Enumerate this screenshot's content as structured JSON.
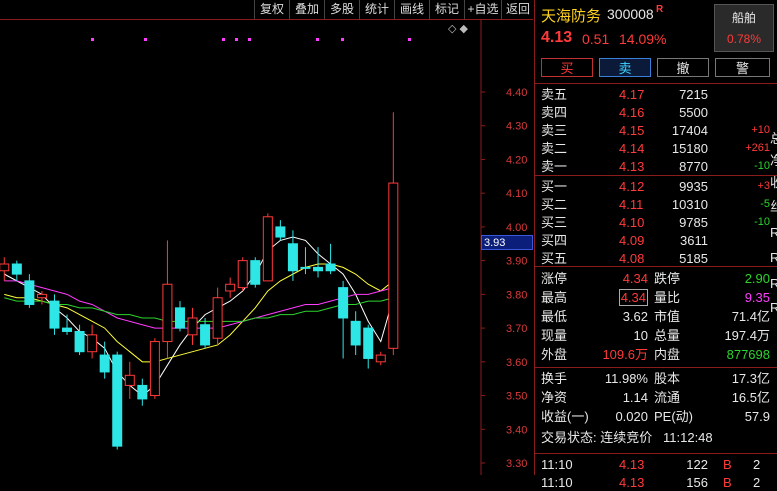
{
  "toolbar": {
    "items": [
      "复权",
      "叠加",
      "多股",
      "统计",
      "画线",
      "标记",
      "+自选",
      "返回"
    ]
  },
  "chart": {
    "price_ticks": [
      "4.40",
      "4.30",
      "4.20",
      "4.10",
      "4.00",
      "3.90",
      "3.80",
      "3.70",
      "3.60",
      "3.50",
      "3.40",
      "3.30"
    ],
    "current_price_tag": "3.93",
    "corner_glyphs": "◇ ◆"
  },
  "stock": {
    "name": "天海防务",
    "code": "300008",
    "badge": "R",
    "price": "4.13",
    "change": "0.51",
    "change_pct": "14.09%",
    "industry": "船舶",
    "industry_pct": "0.78%"
  },
  "trade_buttons": {
    "buy": "买",
    "sell": "卖",
    "cancel": "撤",
    "alert": "警"
  },
  "asks": [
    {
      "label": "卖五",
      "price": "4.17",
      "vol": "7215",
      "chg": ""
    },
    {
      "label": "卖四",
      "price": "4.16",
      "vol": "5500",
      "chg": ""
    },
    {
      "label": "卖三",
      "price": "4.15",
      "vol": "17404",
      "chg": "+10"
    },
    {
      "label": "卖二",
      "price": "4.14",
      "vol": "15180",
      "chg": "+261"
    },
    {
      "label": "卖一",
      "price": "4.13",
      "vol": "8770",
      "chg": "-10"
    }
  ],
  "bids": [
    {
      "label": "买一",
      "price": "4.12",
      "vol": "9935",
      "chg": "+3"
    },
    {
      "label": "买二",
      "price": "4.11",
      "vol": "10310",
      "chg": "-5"
    },
    {
      "label": "买三",
      "price": "4.10",
      "vol": "9785",
      "chg": "-10"
    },
    {
      "label": "买四",
      "price": "4.09",
      "vol": "3611",
      "chg": ""
    },
    {
      "label": "买五",
      "price": "4.08",
      "vol": "5185",
      "chg": ""
    }
  ],
  "stats1": [
    {
      "l1": "涨停",
      "v1": "4.34",
      "l2": "跌停",
      "v2": "2.90"
    },
    {
      "l1": "最高",
      "v1": "4.34",
      "l2": "量比",
      "v2": "9.35"
    },
    {
      "l1": "最低",
      "v1": "3.62",
      "l2": "市值",
      "v2": "71.4亿"
    },
    {
      "l1": "现量",
      "v1": "10",
      "l2": "总量",
      "v2": "197.4万"
    },
    {
      "l1": "外盘",
      "v1": "109.6万",
      "l2": "内盘",
      "v2": "877698"
    }
  ],
  "stats2": [
    {
      "l1": "换手",
      "v1": "11.98%",
      "l2": "股本",
      "v2": "17.3亿"
    },
    {
      "l1": "净资",
      "v1": "1.14",
      "l2": "流通",
      "v2": "16.5亿"
    },
    {
      "l1": "收益(一)",
      "v1": "0.020",
      "l2": "PE(动)",
      "v2": "57.9"
    }
  ],
  "status": {
    "label": "交易状态: 连续竞价",
    "time": "11:12:48"
  },
  "ticks": [
    {
      "time": "11:10",
      "price": "4.13",
      "vol": "122",
      "dir": "B",
      "n": "2"
    },
    {
      "time": "11:10",
      "price": "4.13",
      "vol": "156",
      "dir": "B",
      "n": "2"
    }
  ],
  "edge_glyphs": [
    "总",
    "净",
    "收",
    "丝",
    "R",
    "R",
    "R",
    "R"
  ],
  "colors": {
    "up": "#ff3a3a",
    "down": "#2ee6e6",
    "ma5": "#ffffff",
    "ma10": "#ffff3a",
    "ma20": "#ff3cff",
    "ma60": "#2dd42d"
  },
  "chart_data": {
    "type": "candlestick",
    "y_axis": {
      "min": 3.3,
      "max": 4.4
    },
    "candles": [
      {
        "o": 3.87,
        "h": 3.91,
        "l": 3.84,
        "c": 3.89,
        "dir": "up"
      },
      {
        "o": 3.89,
        "h": 3.9,
        "l": 3.84,
        "c": 3.86,
        "dir": "down"
      },
      {
        "o": 3.84,
        "h": 3.86,
        "l": 3.76,
        "c": 3.77,
        "dir": "down"
      },
      {
        "o": 3.79,
        "h": 3.81,
        "l": 3.77,
        "c": 3.8,
        "dir": "up"
      },
      {
        "o": 3.78,
        "h": 3.8,
        "l": 3.68,
        "c": 3.7,
        "dir": "down"
      },
      {
        "o": 3.7,
        "h": 3.74,
        "l": 3.68,
        "c": 3.69,
        "dir": "down"
      },
      {
        "o": 3.69,
        "h": 3.71,
        "l": 3.62,
        "c": 3.63,
        "dir": "down"
      },
      {
        "o": 3.63,
        "h": 3.71,
        "l": 3.61,
        "c": 3.68,
        "dir": "up"
      },
      {
        "o": 3.62,
        "h": 3.66,
        "l": 3.55,
        "c": 3.57,
        "dir": "down"
      },
      {
        "o": 3.62,
        "h": 3.63,
        "l": 3.34,
        "c": 3.35,
        "dir": "down"
      },
      {
        "o": 3.53,
        "h": 3.6,
        "l": 3.49,
        "c": 3.56,
        "dir": "up"
      },
      {
        "o": 3.53,
        "h": 3.55,
        "l": 3.47,
        "c": 3.49,
        "dir": "down"
      },
      {
        "o": 3.5,
        "h": 3.67,
        "l": 3.49,
        "c": 3.66,
        "dir": "up"
      },
      {
        "o": 3.66,
        "h": 3.96,
        "l": 3.61,
        "c": 3.83,
        "dir": "up"
      },
      {
        "o": 3.76,
        "h": 3.78,
        "l": 3.69,
        "c": 3.7,
        "dir": "down"
      },
      {
        "o": 3.68,
        "h": 3.76,
        "l": 3.65,
        "c": 3.73,
        "dir": "up"
      },
      {
        "o": 3.71,
        "h": 3.73,
        "l": 3.64,
        "c": 3.65,
        "dir": "down"
      },
      {
        "o": 3.67,
        "h": 3.82,
        "l": 3.65,
        "c": 3.79,
        "dir": "up"
      },
      {
        "o": 3.81,
        "h": 3.85,
        "l": 3.79,
        "c": 3.83,
        "dir": "up"
      },
      {
        "o": 3.82,
        "h": 3.91,
        "l": 3.81,
        "c": 3.9,
        "dir": "up"
      },
      {
        "o": 3.9,
        "h": 3.91,
        "l": 3.82,
        "c": 3.83,
        "dir": "down"
      },
      {
        "o": 3.84,
        "h": 4.04,
        "l": 3.84,
        "c": 4.03,
        "dir": "up"
      },
      {
        "o": 4.0,
        "h": 4.02,
        "l": 3.96,
        "c": 3.97,
        "dir": "down"
      },
      {
        "o": 3.95,
        "h": 3.99,
        "l": 3.84,
        "c": 3.87,
        "dir": "down"
      },
      {
        "o": 3.88,
        "h": 3.94,
        "l": 3.86,
        "c": 3.88,
        "dir": "down"
      },
      {
        "o": 3.87,
        "h": 3.94,
        "l": 3.85,
        "c": 3.88,
        "dir": "down"
      },
      {
        "o": 3.89,
        "h": 3.95,
        "l": 3.86,
        "c": 3.87,
        "dir": "down"
      },
      {
        "o": 3.82,
        "h": 3.84,
        "l": 3.61,
        "c": 3.73,
        "dir": "down"
      },
      {
        "o": 3.72,
        "h": 3.75,
        "l": 3.62,
        "c": 3.65,
        "dir": "down"
      },
      {
        "o": 3.7,
        "h": 3.71,
        "l": 3.58,
        "c": 3.61,
        "dir": "down"
      },
      {
        "o": 3.6,
        "h": 3.63,
        "l": 3.59,
        "c": 3.62,
        "dir": "up"
      },
      {
        "o": 3.64,
        "h": 4.34,
        "l": 3.62,
        "c": 4.13,
        "dir": "up"
      }
    ],
    "ma_lines": {
      "ma5": [
        3.86,
        3.84,
        3.82,
        3.8,
        3.76,
        3.73,
        3.69,
        3.67,
        3.64,
        3.57,
        3.53,
        3.5,
        3.53,
        3.59,
        3.65,
        3.7,
        3.74,
        3.76,
        3.78,
        3.81,
        3.86,
        3.93,
        3.96,
        3.97,
        3.96,
        3.92,
        3.89,
        3.86,
        3.8,
        3.72,
        3.66,
        3.79
      ],
      "ma10": [
        3.8,
        3.79,
        3.79,
        3.78,
        3.77,
        3.76,
        3.74,
        3.72,
        3.7,
        3.66,
        3.63,
        3.6,
        3.6,
        3.61,
        3.62,
        3.63,
        3.64,
        3.65,
        3.68,
        3.72,
        3.76,
        3.81,
        3.84,
        3.86,
        3.88,
        3.89,
        3.89,
        3.88,
        3.86,
        3.83,
        3.81,
        3.84
      ],
      "ma20": [
        3.84,
        3.84,
        3.83,
        3.82,
        3.81,
        3.8,
        3.78,
        3.77,
        3.75,
        3.73,
        3.72,
        3.71,
        3.7,
        3.7,
        3.7,
        3.7,
        3.7,
        3.7,
        3.71,
        3.72,
        3.73,
        3.74,
        3.75,
        3.76,
        3.77,
        3.77,
        3.78,
        3.79,
        3.8,
        3.8,
        3.81,
        3.82
      ],
      "ma60": [
        3.79,
        3.78,
        3.78,
        3.78,
        3.77,
        3.77,
        3.76,
        3.76,
        3.75,
        3.74,
        3.74,
        3.73,
        3.73,
        3.72,
        3.72,
        3.72,
        3.72,
        3.72,
        3.72,
        3.72,
        3.73,
        3.73,
        3.74,
        3.74,
        3.75,
        3.75,
        3.76,
        3.77,
        3.77,
        3.78,
        3.78,
        3.79
      ]
    },
    "event_markers": [
      3,
      5,
      8,
      9,
      11,
      13,
      15,
      19
    ]
  }
}
